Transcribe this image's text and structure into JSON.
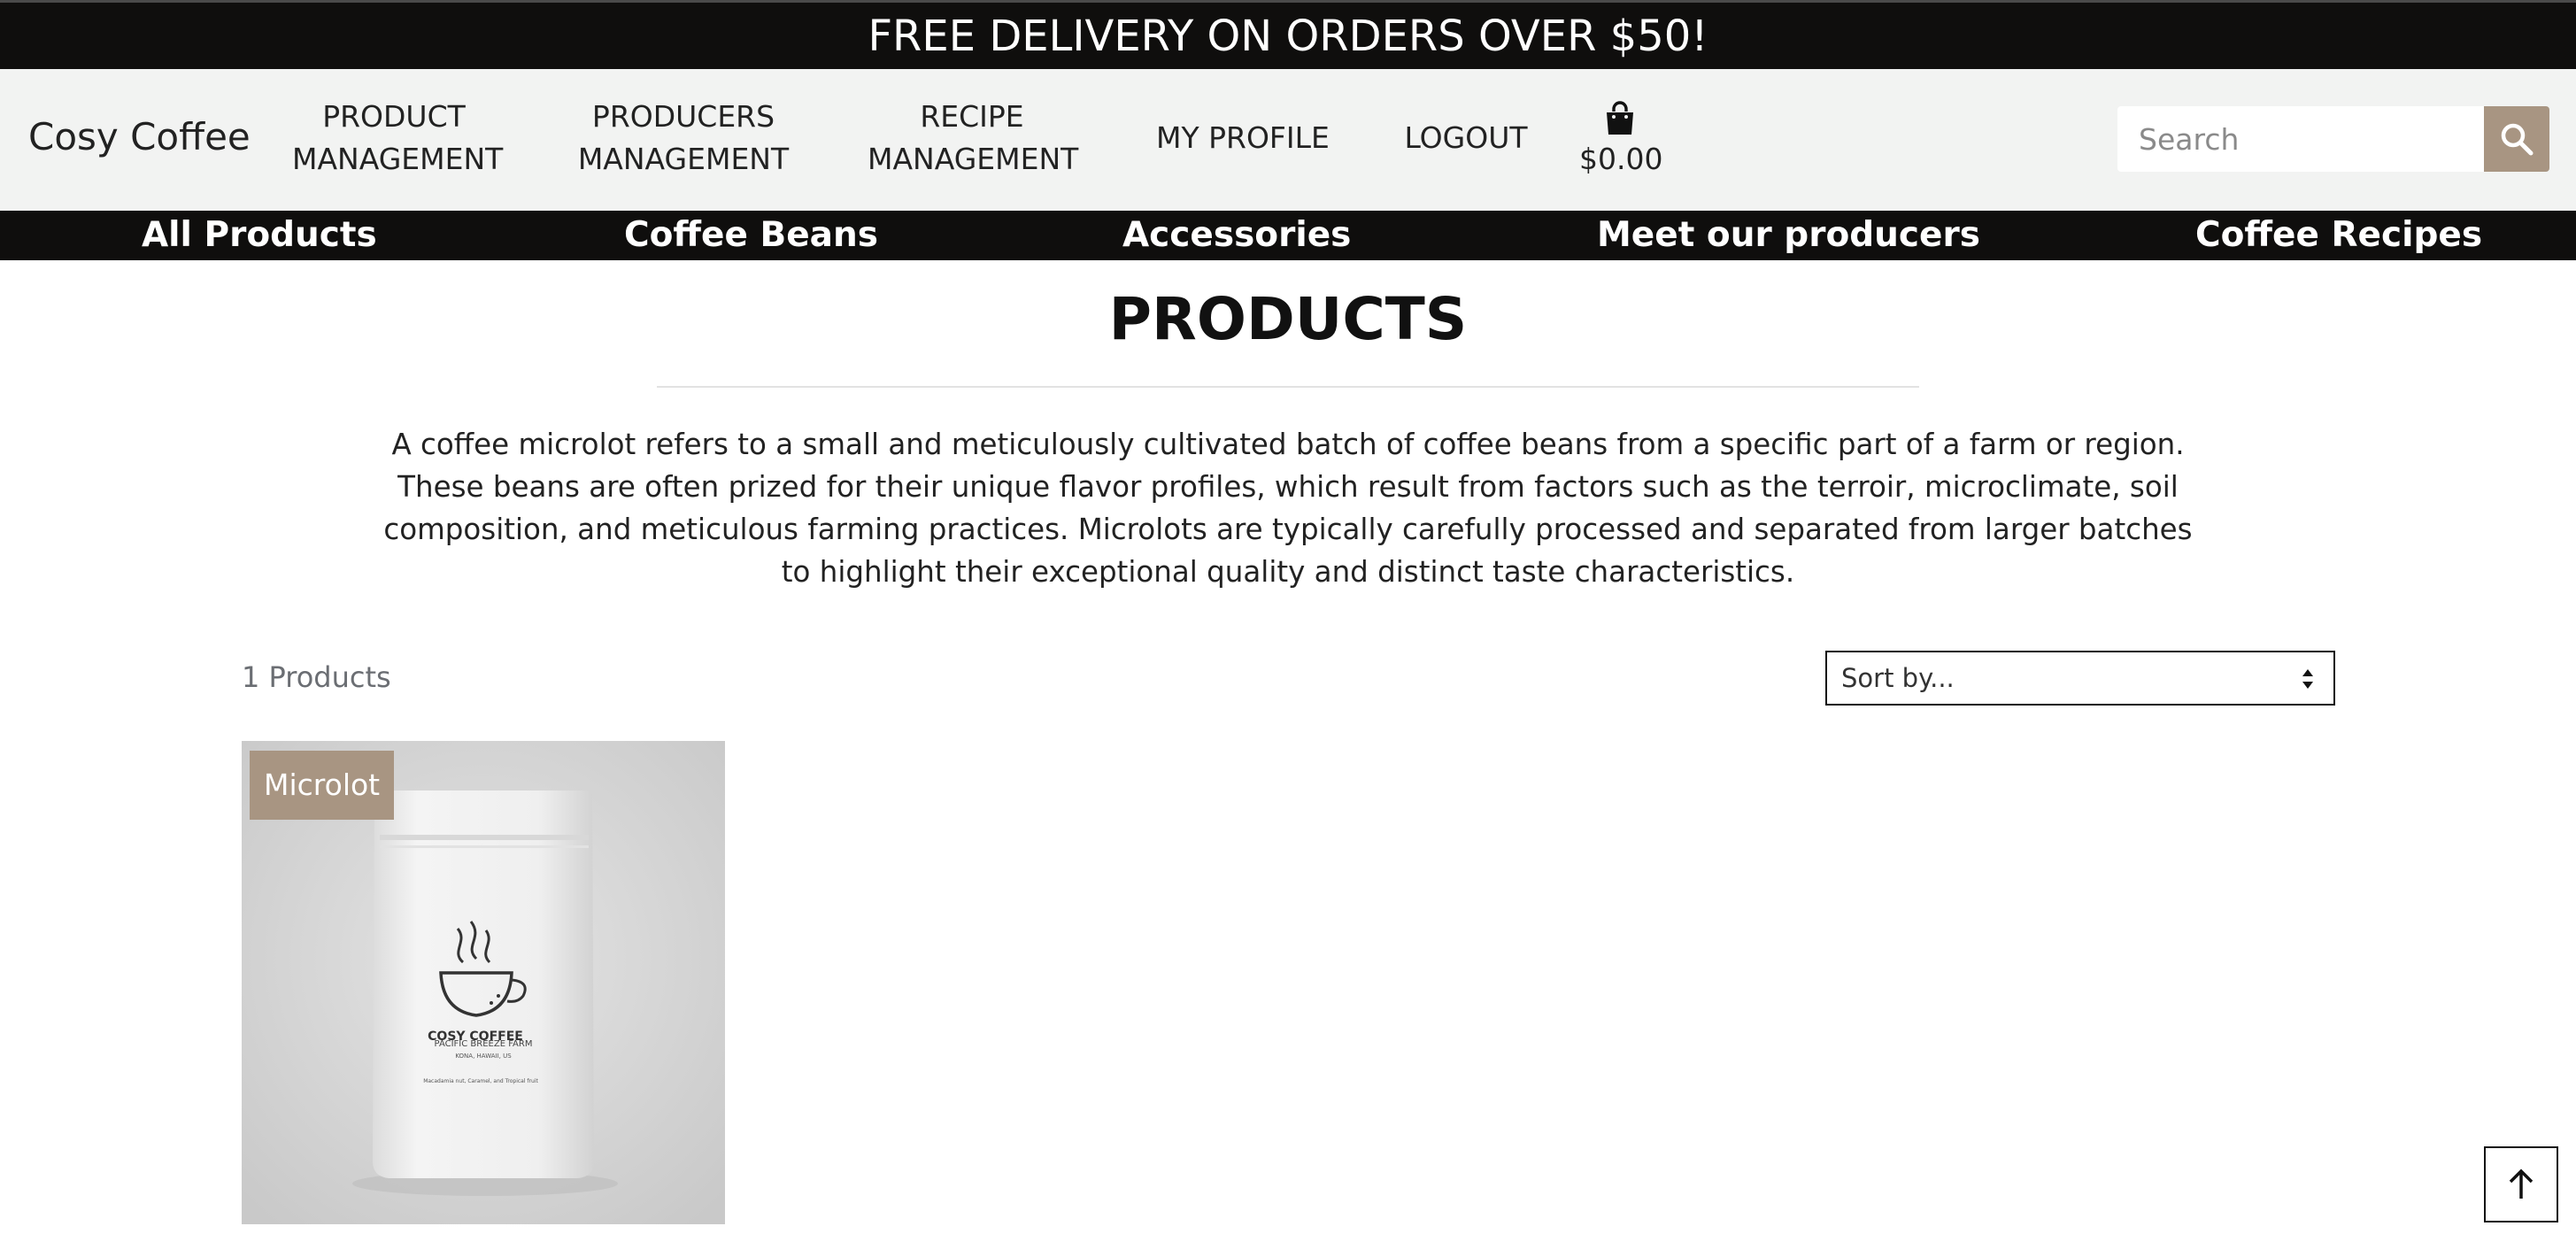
{
  "banner": {
    "text": "FREE DELIVERY ON ORDERS OVER $50!"
  },
  "header": {
    "brand": "Cosy Coffee",
    "nav": [
      {
        "line1": "PRODUCT",
        "line2": "MANAGEMENT"
      },
      {
        "line1": "PRODUCERS",
        "line2": "MANAGEMENT"
      },
      {
        "line1": "RECIPE",
        "line2": "MANAGEMENT"
      },
      {
        "line1": "MY PROFILE"
      },
      {
        "line1": "LOGOUT"
      }
    ],
    "cart_total": "$0.00",
    "cart_icon": "shopping-bag-icon",
    "search": {
      "placeholder": "Search",
      "icon": "search-icon"
    }
  },
  "categories": [
    "All Products",
    "Coffee Beans",
    "Accessories",
    "Meet our producers",
    "Coffee Recipes"
  ],
  "main": {
    "title": "PRODUCTS",
    "description": "A coffee microlot refers to a small and meticulously cultivated batch of coffee beans from a specific part of a farm or region. These beans are often prized for their unique flavor profiles, which result from factors such as the terroir, microclimate, soil composition, and meticulous farming practices. Microlots are typically carefully processed and separated from larger batches to highlight their exceptional quality and distinct taste characteristics.",
    "count": "1 Products",
    "sort": {
      "selected": "Sort by..."
    },
    "products": [
      {
        "tag": "Microlot",
        "package": {
          "brand": "COSY COFFEE",
          "farm": "PACIFIC BREEZE FARM",
          "location": "KONA, HAWAII, US",
          "notes": "Macadamia nut, Caramel, and Tropical fruit"
        }
      }
    ]
  },
  "back_to_top": {
    "icon": "arrow-up-icon"
  },
  "colors": {
    "dark": "#0f0e0d",
    "accent": "#a89582",
    "header_bg": "#f2f3f2"
  }
}
